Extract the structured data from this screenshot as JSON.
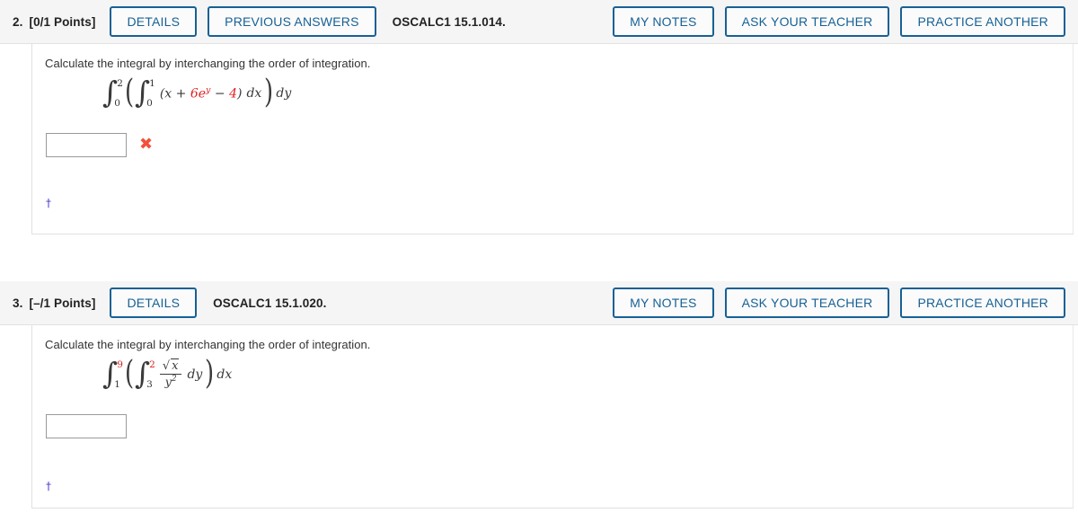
{
  "problems": [
    {
      "number": "2.",
      "points": "[0/1 Points]",
      "code": "OSCALC1 15.1.014.",
      "buttons_left": [
        "DETAILS",
        "PREVIOUS ANSWERS"
      ],
      "buttons_right": [
        "MY NOTES",
        "ASK YOUR TEACHER",
        "PRACTICE ANOTHER"
      ],
      "prompt": "Calculate the integral by interchanging the order of integration.",
      "math": {
        "outer_upper": "2",
        "outer_lower": "0",
        "inner_upper": "1",
        "inner_lower": "0",
        "integrand": "(x + 6eʸ − 4)",
        "integrand_plain_open": "(x + ",
        "integrand_red_1": "6e",
        "integrand_red_exp": "y",
        "integrand_mid": " − ",
        "integrand_red_2": "4",
        "integrand_close": ")",
        "inner_diff": "dx",
        "outer_diff": "dy"
      },
      "answer_value": "",
      "answer_placeholder": "",
      "result_mark": "✖",
      "result_status": "incorrect",
      "footnote": "†"
    },
    {
      "number": "3.",
      "points": "[–/1 Points]",
      "code": "OSCALC1 15.1.020.",
      "buttons_left": [
        "DETAILS"
      ],
      "buttons_right": [
        "MY NOTES",
        "ASK YOUR TEACHER",
        "PRACTICE ANOTHER"
      ],
      "prompt": "Calculate the integral by interchanging the order of integration.",
      "math": {
        "outer_upper": "9",
        "outer_lower": "1",
        "inner_upper": "2",
        "inner_lower": "3",
        "numerator_radical": "√",
        "numerator_var": "x",
        "denominator": "y",
        "denominator_exp": "2",
        "inner_diff": "dy",
        "outer_diff": "dx"
      },
      "answer_value": "",
      "answer_placeholder": "",
      "result_mark": "",
      "result_status": "unanswered",
      "footnote": "†"
    }
  ],
  "colors": {
    "button_blue": "#176195",
    "header_bg": "#f5f5f5",
    "red_variable": "#e02020",
    "incorrect_red": "#f4503c",
    "dagger_blue": "#4b3bd6"
  }
}
